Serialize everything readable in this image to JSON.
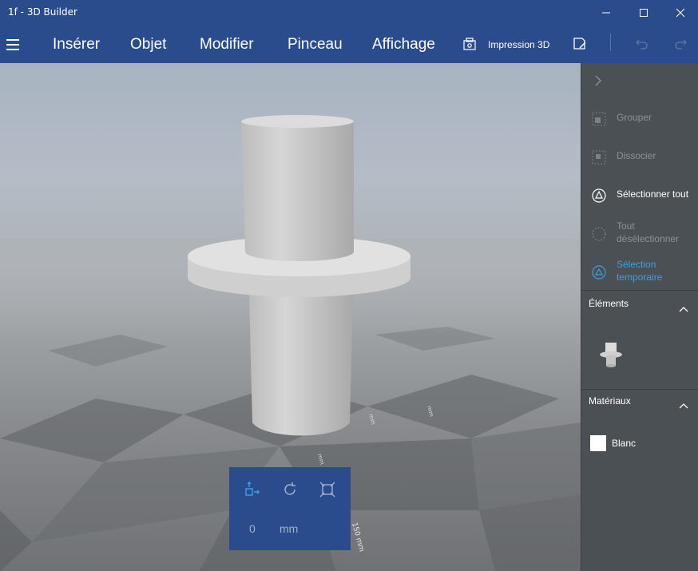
{
  "window": {
    "title": "1f - 3D Builder"
  },
  "menu": {
    "items": [
      "Insérer",
      "Objet",
      "Modifier",
      "Pinceau",
      "Affichage"
    ],
    "print_label": "Impression 3D"
  },
  "viewport": {
    "ruler_labels": [
      "mm",
      "mm",
      "mm",
      "150 mm"
    ]
  },
  "control": {
    "value": "0",
    "unit": "mm"
  },
  "panel": {
    "group": "Grouper",
    "ungroup": "Dissocier",
    "select_all": "Sélectionner tout",
    "deselect_all": "Tout désélectionner",
    "temp_selection": "Sélection temporaire",
    "elements_title": "Éléments",
    "materials_title": "Matériaux",
    "material_name": "Blanc"
  },
  "colors": {
    "accent": "#3aa0e6",
    "titlebar": "#2b4c8c",
    "panel": "#4b5055"
  }
}
